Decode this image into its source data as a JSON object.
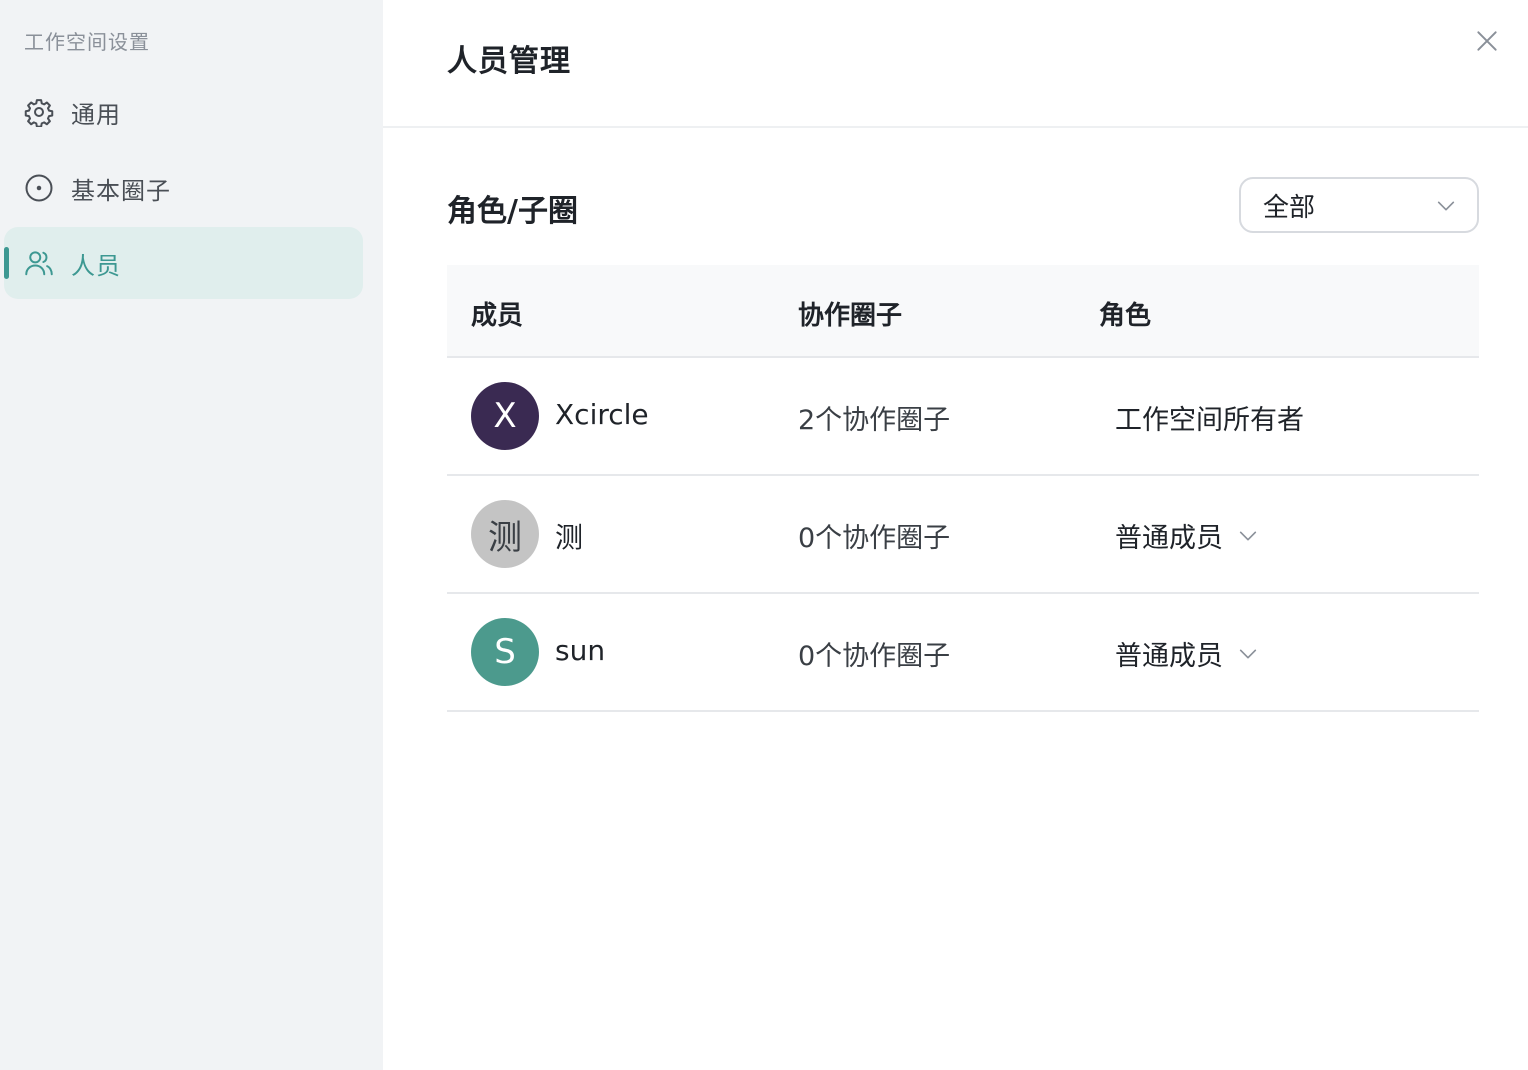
{
  "sidebar": {
    "title": "工作空间设置",
    "items": [
      {
        "label": "通用",
        "icon": "gear-icon",
        "active": false
      },
      {
        "label": "基本圈子",
        "icon": "circle-dot-icon",
        "active": false
      },
      {
        "label": "人员",
        "icon": "users-icon",
        "active": true
      }
    ]
  },
  "header": {
    "title": "人员管理"
  },
  "section": {
    "title": "角色/子圈",
    "filter_value": "全部"
  },
  "table": {
    "columns": [
      "成员",
      "协作圈子",
      "角色"
    ],
    "rows": [
      {
        "avatar_text": "X",
        "avatar_color": "#3a2a52",
        "name": "Xcircle",
        "circles": "2个协作圈子",
        "role": "工作空间所有者",
        "role_editable": false
      },
      {
        "avatar_text": "测",
        "avatar_color": "#c4c4c4",
        "name": "测",
        "circles": "0个协作圈子",
        "role": "普通成员",
        "role_editable": true
      },
      {
        "avatar_text": "S",
        "avatar_color": "#4c9a8d",
        "name": "sun",
        "circles": "0个协作圈子",
        "role": "普通成员",
        "role_editable": true
      }
    ]
  },
  "colors": {
    "accent": "#3d9892",
    "active_bg": "#e0eeed",
    "sidebar_bg": "#f1f3f5"
  }
}
